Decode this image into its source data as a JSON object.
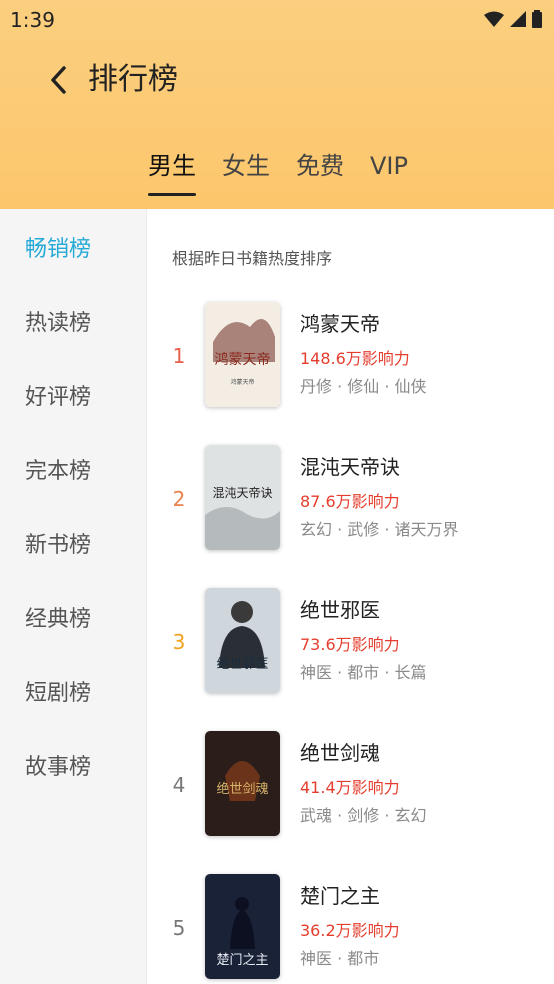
{
  "status": {
    "time": "1:39"
  },
  "header": {
    "title": "排行榜"
  },
  "tabs": [
    {
      "label": "男生",
      "active": true
    },
    {
      "label": "女生",
      "active": false
    },
    {
      "label": "免费",
      "active": false
    },
    {
      "label": "VIP",
      "active": false
    }
  ],
  "sidebar": {
    "items": [
      {
        "label": "畅销榜",
        "active": true
      },
      {
        "label": "热读榜"
      },
      {
        "label": "好评榜"
      },
      {
        "label": "完本榜"
      },
      {
        "label": "新书榜"
      },
      {
        "label": "经典榜"
      },
      {
        "label": "短剧榜"
      },
      {
        "label": "故事榜"
      }
    ]
  },
  "list": {
    "subtitle": "根据昨日书籍热度排序",
    "books": [
      {
        "rank": "1",
        "rank_color": "#e8604c",
        "name": "鸿蒙天帝",
        "heat": "148.6万影响力",
        "tags": "丹修 · 修仙 · 仙侠",
        "cover_text": "鸿蒙天帝",
        "cover_sub": "鸿蒙天帝",
        "cover_bg": "#f3ede4",
        "cover_accent": "#8a2a1e"
      },
      {
        "rank": "2",
        "rank_color": "#e8804c",
        "name": "混沌天帝诀",
        "heat": "87.6万影响力",
        "tags": "玄幻 · 武修 · 诸天万界",
        "cover_text": "混沌天帝诀",
        "cover_sub": "",
        "cover_bg": "#dfe2e3",
        "cover_accent": "#1e1e1e"
      },
      {
        "rank": "3",
        "rank_color": "#f0a21e",
        "name": "绝世邪医",
        "heat": "73.6万影响力",
        "tags": "神医 · 都市 · 长篇",
        "cover_text": "绝世邪医",
        "cover_sub": "",
        "cover_bg": "#cfd6dc",
        "cover_accent": "#1c2e3e"
      },
      {
        "rank": "4",
        "rank_color": "#777777",
        "name": "绝世剑魂",
        "heat": "41.4万影响力",
        "tags": "武魂 · 剑修 · 玄幻",
        "cover_text": "绝世剑魂",
        "cover_sub": "",
        "cover_bg": "#2a1d1a",
        "cover_accent": "#d8b36a"
      },
      {
        "rank": "5",
        "rank_color": "#777777",
        "name": "楚门之主",
        "heat": "36.2万影响力",
        "tags": "神医 · 都市",
        "cover_text": "楚门之主",
        "cover_sub": "",
        "cover_bg": "#1a2238",
        "cover_accent": "#e6eaf2"
      }
    ]
  }
}
